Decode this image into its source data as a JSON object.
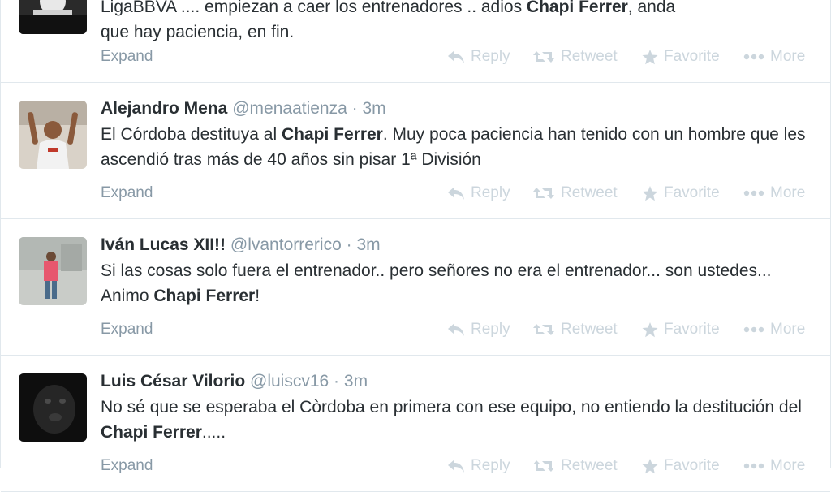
{
  "tweets": [
    {
      "text_lines": [
        "LigaBBVA .... empiezan a caer los entrenadores .. adios ",
        "Chapi Ferrer",
        ", anda",
        "que hay paciencia, en fin."
      ],
      "expand": "Expand"
    },
    {
      "fullname": "Alejandro Mena",
      "handle": "@menaatienza",
      "separator": "·",
      "time": "3m",
      "text_pre": "El Córdoba destituya al ",
      "text_bold": "Chapi Ferrer",
      "text_post": ". Muy poca paciencia han tenido con un hombre que les ascendió tras más de 40 años sin pisar 1ª División",
      "expand": "Expand"
    },
    {
      "fullname": "Iván Lucas XII!!",
      "handle": "@lvantorrerico",
      "separator": "·",
      "time": "3m",
      "text_pre": "Si las cosas solo fuera el entrenador.. pero señores no era el entrenador... son ustedes... Animo ",
      "text_bold": "Chapi Ferrer",
      "text_post": "!",
      "expand": "Expand"
    },
    {
      "fullname": "Luis César Vilorio",
      "handle": "@luiscv16",
      "separator": "·",
      "time": "3m",
      "text_pre": "No sé que se esperaba el Còrdoba en primera con ese equipo, no entiendo la destitución del ",
      "text_bold": "Chapi Ferrer",
      "text_post": ".....",
      "expand": "Expand"
    }
  ],
  "actions": {
    "reply": "Reply",
    "retweet": "Retweet",
    "favorite": "Favorite",
    "more": "More"
  },
  "icons": [
    "reply-icon",
    "retweet-icon",
    "star-icon",
    "more-dots-icon"
  ],
  "colors": {
    "text": "#292f33",
    "muted": "#8899a6",
    "action": "#ccd6dd",
    "divider": "#e1e8ed"
  }
}
